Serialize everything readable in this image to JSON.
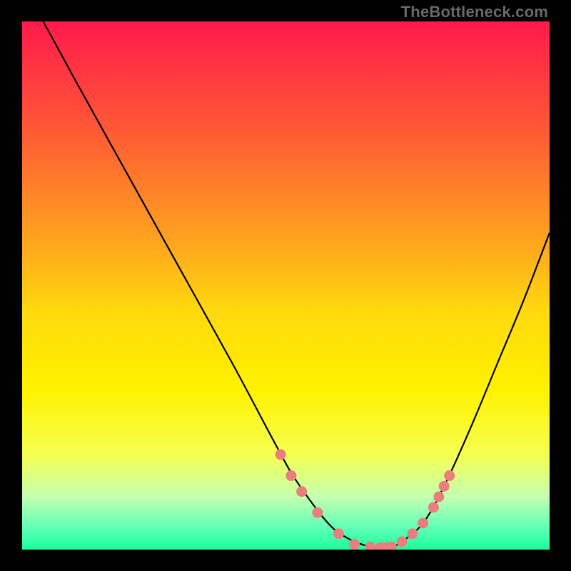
{
  "watermark": "TheBottleneck.com",
  "chart_data": {
    "type": "line",
    "title": "",
    "xlabel": "",
    "ylabel": "",
    "xlim": [
      0,
      100
    ],
    "ylim": [
      0,
      100
    ],
    "grid": false,
    "gradient_stops": [
      {
        "t": 0.0,
        "color": "#ff1a4b"
      },
      {
        "t": 0.2,
        "color": "#ff5736"
      },
      {
        "t": 0.4,
        "color": "#ff9e20"
      },
      {
        "t": 0.55,
        "color": "#ffd90e"
      },
      {
        "t": 0.7,
        "color": "#fff200"
      },
      {
        "t": 0.82,
        "color": "#f6ff52"
      },
      {
        "t": 0.9,
        "color": "#c5ffb0"
      },
      {
        "t": 0.96,
        "color": "#5dffb6"
      },
      {
        "t": 1.0,
        "color": "#1bff9d"
      }
    ],
    "series": [
      {
        "name": "bottleneck-curve",
        "x": [
          4,
          10,
          20,
          30,
          40,
          48,
          52,
          58,
          62,
          66,
          68,
          70,
          72,
          76,
          80,
          85,
          90,
          95,
          100
        ],
        "y": [
          100,
          89,
          71,
          53,
          35,
          20,
          13,
          5,
          2,
          0.5,
          0.3,
          0.5,
          1.5,
          5,
          12,
          23,
          35,
          47,
          60
        ]
      }
    ],
    "markers": {
      "name": "highlight-points",
      "x": [
        49,
        51,
        53,
        56,
        60,
        63,
        66,
        68,
        69,
        70,
        72,
        74,
        76,
        78,
        79,
        80,
        81
      ],
      "y": [
        18,
        14,
        11,
        7,
        3,
        1,
        0.5,
        0.4,
        0.4,
        0.5,
        1.5,
        3,
        5,
        8,
        10,
        12,
        14
      ]
    }
  }
}
